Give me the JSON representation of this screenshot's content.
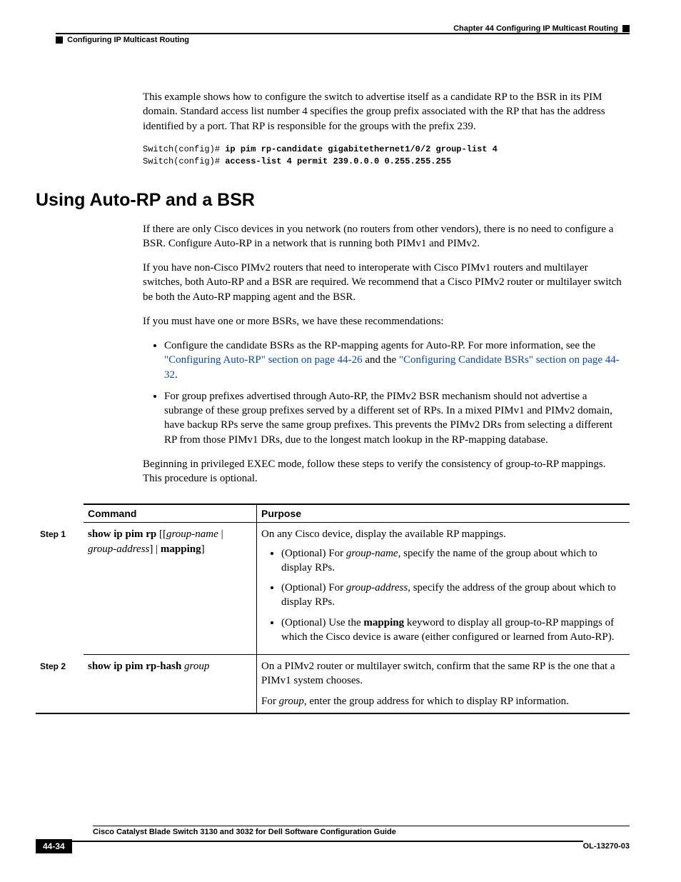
{
  "header": {
    "chapter": "Chapter 44    Configuring IP Multicast Routing",
    "section": "Configuring IP Multicast Routing"
  },
  "intro_para": "This example shows how to configure the switch to advertise itself as a candidate RP to the BSR in its PIM domain. Standard access list number 4 specifies the group prefix associated with the RP that has the address identified by a port. That RP is responsible for the groups with the prefix 239.",
  "code": {
    "prompt1": "Switch(config)# ",
    "cmd1": "ip pim rp-candidate gigabitethernet1/0/2 group-list 4",
    "prompt2": "Switch(config)# ",
    "cmd2": "access-list 4 permit 239.0.0.0 0.255.255.255"
  },
  "heading": "Using Auto-RP and a BSR",
  "para1": "If there are only Cisco devices in you network (no routers from other vendors), there is no need to configure a BSR. Configure Auto-RP in a network that is running both PIMv1 and PIMv2.",
  "para2": "If you have non-Cisco PIMv2 routers that need to interoperate with Cisco PIMv1 routers and multilayer switches, both Auto-RP and a BSR are required. We recommend that a Cisco PIMv2 router or multilayer switch be both the Auto-RP mapping agent and the BSR.",
  "para3": "If you must have one or more BSRs, we have these recommendations:",
  "bullets": {
    "b1_a": "Configure the candidate BSRs as the RP-mapping agents for Auto-RP. For more information, see the ",
    "b1_link1": "\"Configuring Auto-RP\" section on page 44-26",
    "b1_mid": " and the ",
    "b1_link2": "\"Configuring Candidate BSRs\" section on page 44-32",
    "b1_end": ".",
    "b2": "For group prefixes advertised through Auto-RP, the PIMv2 BSR mechanism should not advertise a subrange of these group prefixes served by a different set of RPs. In a mixed PIMv1 and PIMv2 domain, have backup RPs serve the same group prefixes. This prevents the PIMv2 DRs from selecting a different RP from those PIMv1 DRs, due to the longest match lookup in the RP-mapping database."
  },
  "para4": "Beginning in privileged EXEC mode, follow these steps to verify the consistency of group-to-RP mappings. This procedure is optional.",
  "table": {
    "h_step": "",
    "h_cmd": "Command",
    "h_purpose": "Purpose",
    "step1": "Step 1",
    "step2": "Step 2",
    "cmd1_b1": "show ip pim rp",
    "cmd1_i1": "group-name",
    "cmd1_i2": "group-address",
    "cmd1_b2": "mapping",
    "purpose1_main": "On any Cisco device, display the available RP mappings.",
    "purpose1_bullets": {
      "pb1_a": "(Optional) For ",
      "pb1_i": "group-name",
      "pb1_b": ", specify the name of the group about which to display RPs.",
      "pb2_a": "(Optional) For ",
      "pb2_i": "group-address",
      "pb2_b": ", specify the address of the group about which to display RPs.",
      "pb3_a": "(Optional) Use the ",
      "pb3_b": "mapping",
      "pb3_c": " keyword to display all group-to-RP mappings of which the Cisco device is aware (either configured or learned from Auto-RP)."
    },
    "cmd2_b": "show ip pim rp-hash",
    "cmd2_i": "group",
    "purpose2_a": "On a PIMv2 router or multilayer switch, confirm that the same RP is the one that a PIMv1 system chooses.",
    "purpose2_b1": "For ",
    "purpose2_i": "group",
    "purpose2_b2": ", enter the group address for which to display RP information."
  },
  "footer": {
    "title": "Cisco Catalyst Blade Switch 3130 and 3032 for Dell Software Configuration Guide",
    "page": "44-34",
    "doc": "OL-13270-03"
  }
}
